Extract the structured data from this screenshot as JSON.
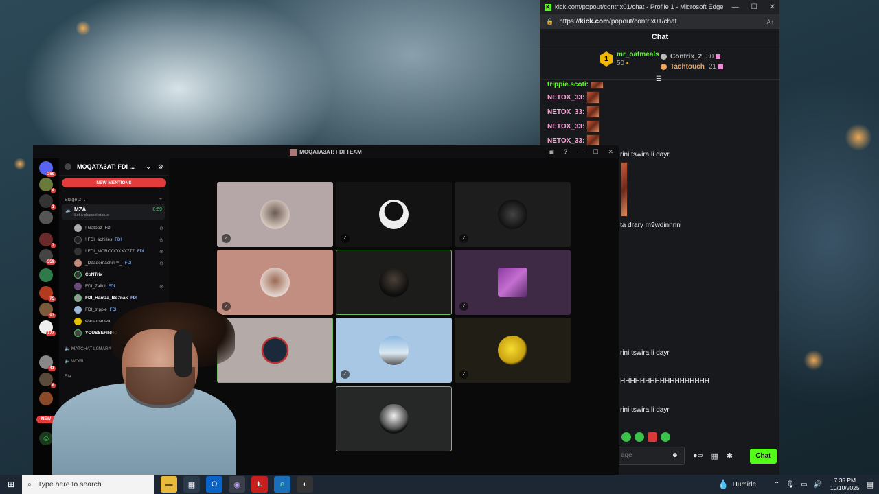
{
  "edge": {
    "title": "kick.com/popout/contrix01/chat - Profile 1 - Microsoft Edge",
    "url_prefix": "https://",
    "url_host": "kick.com",
    "url_path": "/popout/contrix01/chat",
    "chat_header": "Chat",
    "leaderboard": {
      "first_rank": "1",
      "first_name": "mr_oatmeals",
      "first_points": "50",
      "others": [
        {
          "name": "Contrix_2",
          "points": "30",
          "color": "#bbbbbb"
        },
        {
          "name": "Tachtouch",
          "points": "21",
          "color": "#f2a65a"
        }
      ]
    },
    "messages": [
      {
        "user": "trippie.scoti:"
      },
      {
        "user": "NETOX_33:"
      },
      {
        "user": "NETOX_33:"
      },
      {
        "user": "NETOX_33:"
      },
      {
        "user": "NETOX_33:"
      }
    ],
    "visible_texts": [
      "rini tswira li dayr",
      "ta drary m9wdinnnn",
      "rini tswira li dayr",
      "HHHHHHHHHHHHHHHHHH",
      "rini tswira li dayr"
    ],
    "input_placeholder": "age",
    "chat_button": "Chat"
  },
  "discord": {
    "window_title": "MOQATA3AT: FDI TEAM",
    "server_name": "MOQATA3AT: FDI ...",
    "new_mentions": "NEW MENTIONS",
    "category": "Etage 2",
    "voice_channel": {
      "name": "MZA",
      "status": "Set a channel status",
      "time": "8:59"
    },
    "members": [
      {
        "name": "! Gatooz",
        "tag": "FDI"
      },
      {
        "name": "! FDI_achilles",
        "tag": "FDI"
      },
      {
        "name": "! FDI_MOROOOXXX777",
        "tag": "FDI"
      },
      {
        "name": "_Deademachin™_",
        "tag": "FDI"
      },
      {
        "name": "CoNTrix",
        "tag": ""
      },
      {
        "name": "FDI_7afidi",
        "tag": "FDI"
      },
      {
        "name": "FDI_Hamza_Bo7nak",
        "tag": "FDI"
      },
      {
        "name": "FDI_trippie",
        "tag": "FDI"
      },
      {
        "name": "wanamanwa",
        "tag": ""
      },
      {
        "name": "YOUSSEFINHO",
        "tag": ""
      }
    ],
    "other_channels": [
      "MATCHAT L9MARA",
      "WORL",
      "Eta"
    ],
    "guild_badges": [
      "269",
      "4",
      "1",
      "7",
      "559",
      "75",
      "93",
      "177",
      "41",
      "8"
    ],
    "new_pill": "NEW"
  },
  "taskbar": {
    "search_placeholder": "Type here to search",
    "weather": "Humide",
    "time": "7:35 PM",
    "date": "10/10/2025"
  }
}
